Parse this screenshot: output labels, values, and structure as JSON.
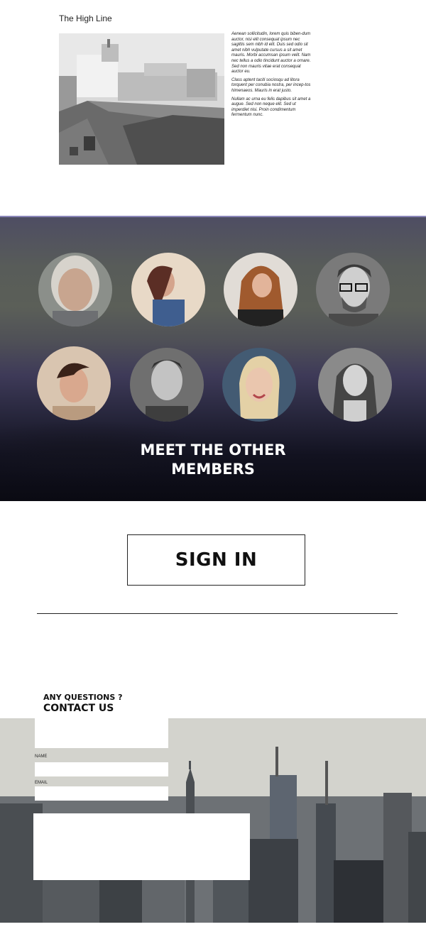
{
  "article": {
    "title": "The High Line",
    "photo_icon": "historic-high-line-photo",
    "paragraphs": [
      "Aenean sollicitudin, lorem quis biben-dum auctor, nisi elit consequat ipsum nec sagittis sem nibh id elit. Duis sed odio sit amet nibh vulputate cursus a sit amet mauris. Morbi accumsan ipsum velit. Nam nec tellus a odio tincidunt auctor a ornare. Sed non mauris vitae erat consequat auctor eu.",
      "Class aptent taciti sociosqu ad litora torquent per conubia nostra, per incep-tos himenaeos. Mauris in erat justo.",
      "Nullam ac urna eu felis dapibus sit amet a augue. Sed non neque elit. Sed ut imperdiet nisi. Proin condimentum fermentum nunc."
    ]
  },
  "members": {
    "heading_line1": "MEET THE OTHER",
    "heading_line2": "MEMBERS",
    "avatars": [
      {
        "name": "older-woman-avatar"
      },
      {
        "name": "woman-denim-avatar"
      },
      {
        "name": "woman-curly-hair-avatar"
      },
      {
        "name": "man-glasses-avatar"
      },
      {
        "name": "woman-short-hair-avatar"
      },
      {
        "name": "man-smiling-avatar"
      },
      {
        "name": "woman-blonde-avatar"
      },
      {
        "name": "woman-long-hair-avatar"
      }
    ]
  },
  "signin": {
    "label": "SIGN IN"
  },
  "contact": {
    "question": "ANY QUESTIONS ?",
    "heading": "CONTACT US",
    "name_label": "NAME",
    "email_label": "EMAIL",
    "background_icon": "city-skyline-photo"
  }
}
